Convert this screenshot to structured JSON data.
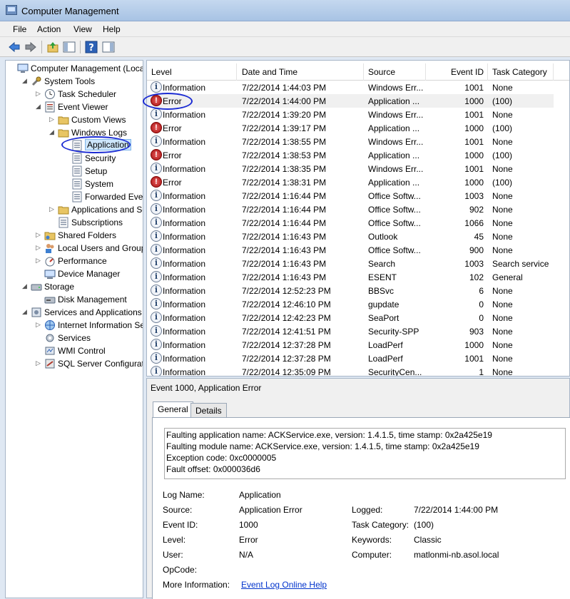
{
  "window": {
    "title": "Computer Management"
  },
  "menu": [
    "File",
    "Action",
    "View",
    "Help"
  ],
  "tree": {
    "items": [
      {
        "label": "Computer Management (Local",
        "indent": 0,
        "expander": "",
        "icon": "computer-icon"
      },
      {
        "label": "System Tools",
        "indent": 1,
        "expander": "◢",
        "icon": "tools-icon"
      },
      {
        "label": "Task Scheduler",
        "indent": 2,
        "expander": "▷",
        "icon": "clock-icon"
      },
      {
        "label": "Event Viewer",
        "indent": 2,
        "expander": "◢",
        "icon": "event-viewer-icon"
      },
      {
        "label": "Custom Views",
        "indent": 3,
        "expander": "▷",
        "icon": "folder-icon"
      },
      {
        "label": "Windows Logs",
        "indent": 3,
        "expander": "◢",
        "icon": "folder-icon"
      },
      {
        "label": "Application",
        "indent": 4,
        "expander": "",
        "icon": "log-icon",
        "selected": true
      },
      {
        "label": "Security",
        "indent": 4,
        "expander": "",
        "icon": "log-icon"
      },
      {
        "label": "Setup",
        "indent": 4,
        "expander": "",
        "icon": "log-icon"
      },
      {
        "label": "System",
        "indent": 4,
        "expander": "",
        "icon": "log-icon"
      },
      {
        "label": "Forwarded Event",
        "indent": 4,
        "expander": "",
        "icon": "log-icon"
      },
      {
        "label": "Applications and Se",
        "indent": 3,
        "expander": "▷",
        "icon": "folder-icon"
      },
      {
        "label": "Subscriptions",
        "indent": 3,
        "expander": "",
        "icon": "log-icon"
      },
      {
        "label": "Shared Folders",
        "indent": 2,
        "expander": "▷",
        "icon": "shared-folder-icon"
      },
      {
        "label": "Local Users and Groups",
        "indent": 2,
        "expander": "▷",
        "icon": "users-icon"
      },
      {
        "label": "Performance",
        "indent": 2,
        "expander": "▷",
        "icon": "performance-icon"
      },
      {
        "label": "Device Manager",
        "indent": 2,
        "expander": "",
        "icon": "device-manager-icon"
      },
      {
        "label": "Storage",
        "indent": 1,
        "expander": "◢",
        "icon": "storage-icon"
      },
      {
        "label": "Disk Management",
        "indent": 2,
        "expander": "",
        "icon": "disk-icon"
      },
      {
        "label": "Services and Applications",
        "indent": 1,
        "expander": "◢",
        "icon": "services-apps-icon"
      },
      {
        "label": "Internet Information Se",
        "indent": 2,
        "expander": "▷",
        "icon": "iis-icon"
      },
      {
        "label": "Services",
        "indent": 2,
        "expander": "",
        "icon": "services-icon"
      },
      {
        "label": "WMI Control",
        "indent": 2,
        "expander": "",
        "icon": "wmi-icon"
      },
      {
        "label": "SQL Server Configuratio",
        "indent": 2,
        "expander": "▷",
        "icon": "sql-icon"
      }
    ]
  },
  "list": {
    "columns": [
      "Level",
      "Date and Time",
      "Source",
      "Event ID",
      "Task Category"
    ],
    "rows": [
      {
        "level": "Information",
        "type": "info",
        "date": "7/22/2014 1:44:03 PM",
        "source": "Windows Err...",
        "id": "1001",
        "cat": "None"
      },
      {
        "level": "Error",
        "type": "error",
        "date": "7/22/2014 1:44:00 PM",
        "source": "Application ...",
        "id": "1000",
        "cat": "(100)",
        "selected": true
      },
      {
        "level": "Information",
        "type": "info",
        "date": "7/22/2014 1:39:20 PM",
        "source": "Windows Err...",
        "id": "1001",
        "cat": "None"
      },
      {
        "level": "Error",
        "type": "error",
        "date": "7/22/2014 1:39:17 PM",
        "source": "Application ...",
        "id": "1000",
        "cat": "(100)"
      },
      {
        "level": "Information",
        "type": "info",
        "date": "7/22/2014 1:38:55 PM",
        "source": "Windows Err...",
        "id": "1001",
        "cat": "None"
      },
      {
        "level": "Error",
        "type": "error",
        "date": "7/22/2014 1:38:53 PM",
        "source": "Application ...",
        "id": "1000",
        "cat": "(100)"
      },
      {
        "level": "Information",
        "type": "info",
        "date": "7/22/2014 1:38:35 PM",
        "source": "Windows Err...",
        "id": "1001",
        "cat": "None"
      },
      {
        "level": "Error",
        "type": "error",
        "date": "7/22/2014 1:38:31 PM",
        "source": "Application ...",
        "id": "1000",
        "cat": "(100)"
      },
      {
        "level": "Information",
        "type": "info",
        "date": "7/22/2014 1:16:44 PM",
        "source": "Office Softw...",
        "id": "1003",
        "cat": "None"
      },
      {
        "level": "Information",
        "type": "info",
        "date": "7/22/2014 1:16:44 PM",
        "source": "Office Softw...",
        "id": "902",
        "cat": "None"
      },
      {
        "level": "Information",
        "type": "info",
        "date": "7/22/2014 1:16:44 PM",
        "source": "Office Softw...",
        "id": "1066",
        "cat": "None"
      },
      {
        "level": "Information",
        "type": "info",
        "date": "7/22/2014 1:16:43 PM",
        "source": "Outlook",
        "id": "45",
        "cat": "None"
      },
      {
        "level": "Information",
        "type": "info",
        "date": "7/22/2014 1:16:43 PM",
        "source": "Office Softw...",
        "id": "900",
        "cat": "None"
      },
      {
        "level": "Information",
        "type": "info",
        "date": "7/22/2014 1:16:43 PM",
        "source": "Search",
        "id": "1003",
        "cat": "Search service"
      },
      {
        "level": "Information",
        "type": "info",
        "date": "7/22/2014 1:16:43 PM",
        "source": "ESENT",
        "id": "102",
        "cat": "General"
      },
      {
        "level": "Information",
        "type": "info",
        "date": "7/22/2014 12:52:23 PM",
        "source": "BBSvc",
        "id": "6",
        "cat": "None"
      },
      {
        "level": "Information",
        "type": "info",
        "date": "7/22/2014 12:46:10 PM",
        "source": "gupdate",
        "id": "0",
        "cat": "None"
      },
      {
        "level": "Information",
        "type": "info",
        "date": "7/22/2014 12:42:23 PM",
        "source": "SeaPort",
        "id": "0",
        "cat": "None"
      },
      {
        "level": "Information",
        "type": "info",
        "date": "7/22/2014 12:41:51 PM",
        "source": "Security-SPP",
        "id": "903",
        "cat": "None"
      },
      {
        "level": "Information",
        "type": "info",
        "date": "7/22/2014 12:37:28 PM",
        "source": "LoadPerf",
        "id": "1000",
        "cat": "None"
      },
      {
        "level": "Information",
        "type": "info",
        "date": "7/22/2014 12:37:28 PM",
        "source": "LoadPerf",
        "id": "1001",
        "cat": "None"
      },
      {
        "level": "Information",
        "type": "info",
        "date": "7/22/2014 12:35:09 PM",
        "source": "SecurityCen...",
        "id": "1",
        "cat": "None"
      }
    ]
  },
  "detail": {
    "title": "Event 1000, Application Error",
    "tabs": [
      "General",
      "Details"
    ],
    "description": [
      "Faulting application name: ACKService.exe, version: 1.4.1.5, time stamp: 0x2a425e19",
      "Faulting module name: ACKService.exe, version: 1.4.1.5, time stamp: 0x2a425e19",
      "Exception code: 0xc0000005",
      "Fault offset: 0x000036d6"
    ],
    "labels": {
      "log_name": "Log Name:",
      "source": "Source:",
      "event_id": "Event ID:",
      "level": "Level:",
      "user": "User:",
      "opcode": "OpCode:",
      "more_info": "More Information:",
      "logged": "Logged:",
      "task_category": "Task Category:",
      "keywords": "Keywords:",
      "computer": "Computer:"
    },
    "values": {
      "log_name": "Application",
      "source": "Application Error",
      "event_id": "1000",
      "level": "Error",
      "user": "N/A",
      "opcode": "",
      "more_info_link": "Event Log Online Help",
      "logged": "7/22/2014 1:44:00 PM",
      "task_category": "(100)",
      "keywords": "Classic",
      "computer": "matlonmi-nb.asol.local"
    }
  },
  "colors": {
    "annotation": "#1b2bd3",
    "selection": "#cde6fb",
    "link": "#0033cc"
  }
}
